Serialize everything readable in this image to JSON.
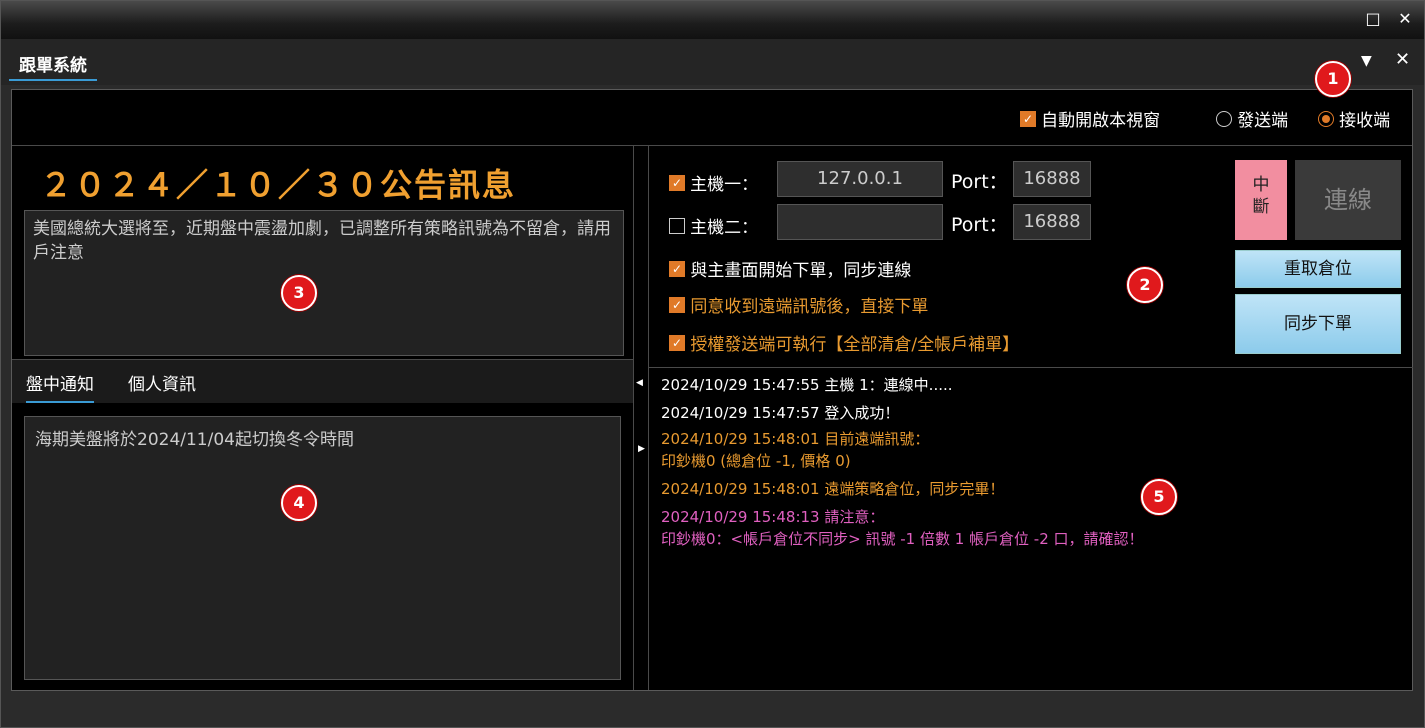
{
  "window": {
    "maximize_glyph": "□",
    "close_glyph": "✕"
  },
  "tab": {
    "title": "跟單系統",
    "menu_glyph": "▼",
    "close_glyph": "✕"
  },
  "top": {
    "auto_open_label": "自動開啟本視窗",
    "auto_open_checked": true,
    "mode_send_label": "發送端",
    "mode_recv_label": "接收端",
    "mode_selected": "接收端"
  },
  "announcement": {
    "title": "２０２４／１０／３０公告訊息",
    "body": "美國總統大選將至，近期盤中震盪加劇，已調整所有策略訊號為不留倉，請用戶注意"
  },
  "subtabs": {
    "tab1": "盤中通知",
    "tab2": "個人資訊"
  },
  "notice": {
    "body": "海期美盤將於2024/11/04起切換冬令時間"
  },
  "connection": {
    "host1_label": "主機一：",
    "host1_checked": true,
    "host1_value": "127.0.0.1",
    "host2_label": "主機二：",
    "host2_checked": false,
    "host2_value": "",
    "port_label": "Port：",
    "port1_value": "16888",
    "port2_value": "16888",
    "opt1": "與主畫面開始下單，同步連線",
    "opt2": "同意收到遠端訊號後，直接下單",
    "opt3": "授權發送端可執行【全部清倉/全帳戶補單】",
    "break_label_1": "中",
    "break_label_2": "斷",
    "connect_label": "連線",
    "reload_label": "重取倉位",
    "sync_label": "同步下單"
  },
  "log": [
    {
      "text": "2024/10/29 15:47:55 主機 1：連線中.....",
      "color": "white"
    },
    {
      "text": "2024/10/29 15:47:57 登入成功！",
      "color": "white"
    },
    {
      "text": "2024/10/29 15:48:01 目前遠端訊號：",
      "color": "orange"
    },
    {
      "text": "印鈔機0 (總倉位 -1, 價格 0)",
      "color": "orange"
    },
    {
      "text": "2024/10/29 15:48:01 遠端策略倉位，同步完畢！",
      "color": "orange"
    },
    {
      "text": "2024/10/29 15:48:13 請注意：",
      "color": "pink"
    },
    {
      "text": "印鈔機0：<帳戶倉位不同步> 訊號 -1 倍數 1 帳戶倉位 -2 口，請確認！",
      "color": "pink"
    }
  ],
  "markers": [
    "1",
    "2",
    "3",
    "4",
    "5"
  ],
  "colors": {
    "accent": "#e07a28",
    "title": "#f0a030",
    "break": "#f28ea0",
    "marker": "#e0191c"
  }
}
